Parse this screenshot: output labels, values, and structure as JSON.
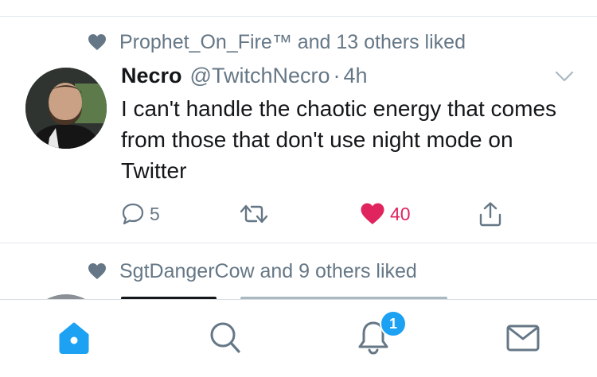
{
  "tweet": {
    "social_context": "Prophet_On_Fire™ and 13 others liked",
    "name": "Necro",
    "handle": "@TwitchNecro",
    "separator": "·",
    "time": "4h",
    "text": "I can't handle the chaotic energy that comes from those that don't use night mode on Twitter",
    "replies": "5",
    "likes": "40",
    "liked": true
  },
  "next_tweet": {
    "social_context": "SgtDangerCow and 9 others liked"
  },
  "tabbar": {
    "tabs": [
      {
        "icon": "home-icon",
        "active": true
      },
      {
        "icon": "search-icon",
        "active": false
      },
      {
        "icon": "bell-icon",
        "active": false
      },
      {
        "icon": "mail-icon",
        "active": false
      }
    ],
    "notification_badge": "1"
  },
  "colors": {
    "accent": "#1da1f2",
    "like": "#e0245e",
    "muted": "#657786",
    "text": "#14171a",
    "divider": "#e1e8ed"
  }
}
